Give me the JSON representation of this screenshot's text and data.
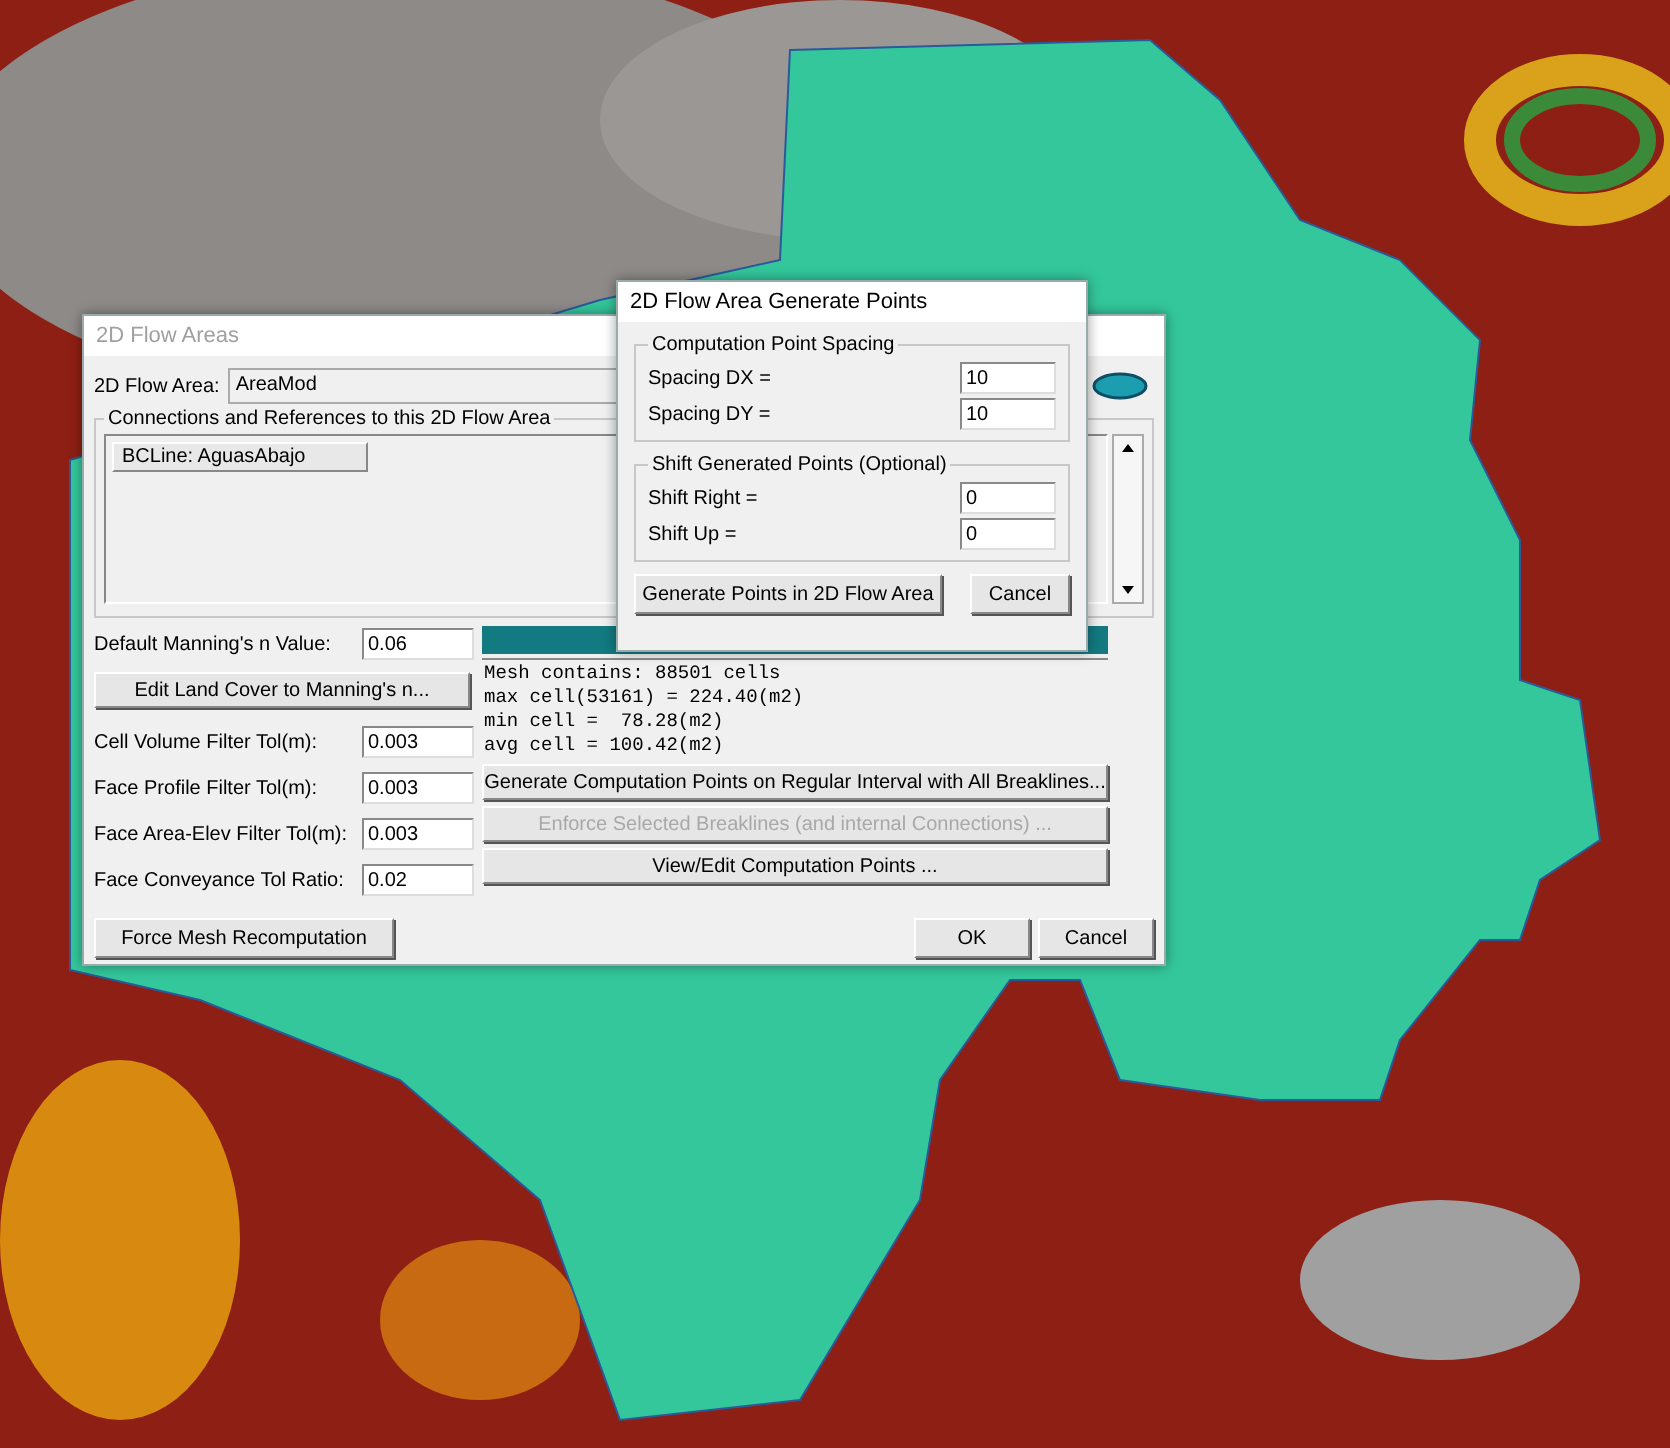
{
  "flow_areas_dialog": {
    "title": "2D Flow Areas",
    "active": false,
    "area_label": "2D Flow Area:",
    "area_value": "AreaMod",
    "connections": {
      "legend": "Connections and References to this 2D Flow Area",
      "items": [
        {
          "label": "BCLine: AguasAbajo"
        }
      ]
    },
    "left_items": [
      {
        "kind": "field",
        "label": "Default Manning's n Value:",
        "value": "0.06"
      },
      {
        "kind": "button",
        "label": "Edit Land Cover to Manning's n..."
      },
      {
        "kind": "field",
        "label": "Cell Volume Filter Tol(m):",
        "value": "0.003"
      },
      {
        "kind": "field",
        "label": "Face Profile Filter Tol(m):",
        "value": "0.003"
      },
      {
        "kind": "field",
        "label": "Face Area-Elev Filter Tol(m):",
        "value": "0.003"
      },
      {
        "kind": "field",
        "label": "Face Conveyance Tol Ratio:",
        "value": "0.02"
      }
    ],
    "mesh_summary": [
      "Mesh contains: 88501 cells",
      "max cell(53161) = 224.40(m2)",
      "min cell =  78.28(m2)",
      "avg cell = 100.42(m2)"
    ],
    "actions": [
      {
        "label": "Generate Computation Points on Regular Interval with All Breaklines...",
        "disabled": false
      },
      {
        "label": "Enforce Selected Breaklines (and internal Connections) ...",
        "disabled": true
      },
      {
        "label": "View/Edit Computation Points ...",
        "disabled": false
      }
    ],
    "force_button": "Force Mesh Recomputation",
    "ok_button": "OK",
    "cancel_button": "Cancel"
  },
  "generate_points_dialog": {
    "title": "2D Flow Area Generate Points",
    "active": true,
    "groups": [
      {
        "legend": "Computation Point Spacing",
        "fields": [
          {
            "label": "Spacing DX =",
            "value": "10"
          },
          {
            "label": "Spacing DY =",
            "value": "10"
          }
        ]
      },
      {
        "legend": "Shift Generated Points (Optional)",
        "fields": [
          {
            "label": "Shift Right =",
            "value": "0"
          },
          {
            "label": "Shift Up =",
            "value": "0"
          }
        ]
      }
    ],
    "generate_button": "Generate Points in 2D Flow Area",
    "cancel_button": "Cancel"
  }
}
